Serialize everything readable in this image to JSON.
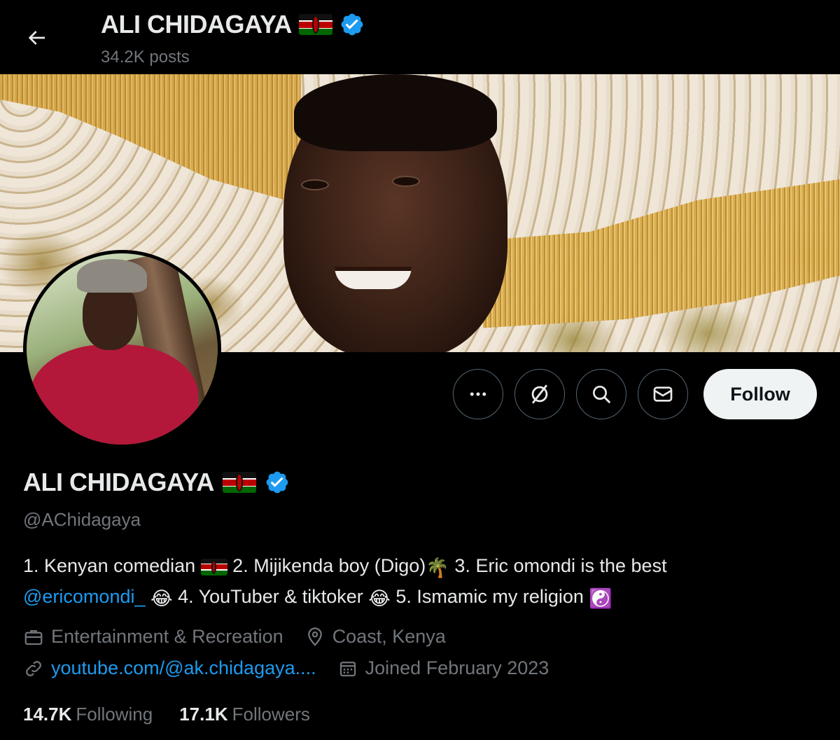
{
  "header": {
    "back_label": "Back",
    "title": "ALI CHIDAGAYA",
    "posts_count": "34.2K posts"
  },
  "profile": {
    "name": "ALI CHIDAGAYA",
    "handle": "@AChidagaya",
    "verified": true,
    "bio": {
      "part1": "1. Kenyan comedian ",
      "part2": " 2. Mijikenda boy (Digo)",
      "part3": " 3. Eric omondi is the best ",
      "mention": "@ericomondi_",
      "part4": " 4. YouTuber & tiktoker ",
      "part5": " 5. Ismamic my religion ",
      "emoji_laugh": "😂",
      "emoji_palm": "🌴",
      "emoji_yinyang": "☯️"
    },
    "category": "Entertainment & Recreation",
    "location": "Coast, Kenya",
    "website": "youtube.com/@ak.chidagaya....",
    "joined": "Joined February 2023"
  },
  "actions": {
    "more_icon": "more-icon",
    "grok_icon": "grok-icon",
    "search_icon": "search-icon",
    "message_icon": "message-icon",
    "follow_label": "Follow"
  },
  "stats": {
    "following_count": "14.7K",
    "following_label": "Following",
    "followers_count": "17.1K",
    "followers_label": "Followers"
  },
  "colors": {
    "background": "#000000",
    "text_primary": "#e7e9ea",
    "text_secondary": "#71767b",
    "accent": "#1d9bf0",
    "follow_button": "#eff3f4"
  }
}
